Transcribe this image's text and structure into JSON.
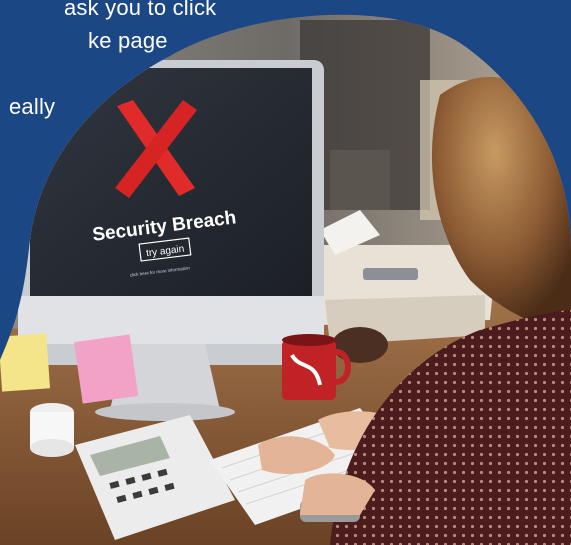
{
  "background_text": {
    "line1": "ask you to click",
    "line2": "ke page",
    "line3": "",
    "line4": "eally"
  },
  "photo": {
    "screen": {
      "title": "Security Breach",
      "button": "try again",
      "subtext": "click here for more information"
    }
  },
  "colors": {
    "background": "#1b4784",
    "x_mark": "#e12a2a",
    "sticky_note": "#f2a2c6"
  }
}
